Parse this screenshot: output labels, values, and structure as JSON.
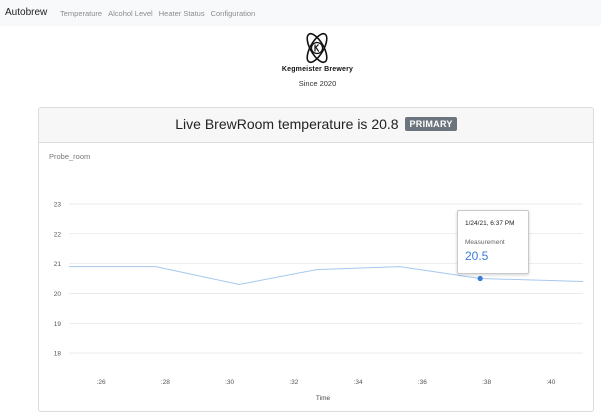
{
  "nav": {
    "brand": "Autobrew",
    "links": [
      "Temperature",
      "Alcohol Level",
      "Heater Status",
      "Configuration"
    ]
  },
  "logo": {
    "icon": "atom-k-logo-icon",
    "brewery_name": "Kegmeister Brewery",
    "since": "Since 2020"
  },
  "card": {
    "title_text": "Live BrewRoom temperature is 20.8",
    "badge": "PRIMARY"
  },
  "tooltip": {
    "date": "1/24/21, 6:37 PM",
    "label": "Measurement",
    "value": "20.5"
  },
  "colors": {
    "line": "#a6c8ef",
    "marker": "#3e7bd6",
    "badge": "#6c757d",
    "navbar": "#f8f9fa"
  },
  "chart_data": {
    "type": "line",
    "title": "Probe_room",
    "xlabel": "Time",
    "ylabel": "",
    "x_ticks": [
      ":26",
      ":28",
      ":30",
      ":32",
      ":34",
      ":36",
      ":38",
      ":40"
    ],
    "x_tick_values": [
      26,
      28,
      30,
      32,
      34,
      36,
      38,
      40
    ],
    "y_ticks": [
      18,
      19,
      20,
      21,
      22,
      23
    ],
    "xlim": [
      25,
      41
    ],
    "ylim": [
      17.5,
      23.3
    ],
    "grid": true,
    "series": [
      {
        "x": [
          25,
          27.7,
          30.3,
          32.7,
          35.3,
          37.8,
          41
        ],
        "y": [
          20.9,
          20.9,
          20.3,
          20.8,
          20.9,
          20.5,
          20.4
        ]
      }
    ],
    "highlight": {
      "x": 37.8,
      "y": 20.5
    }
  }
}
